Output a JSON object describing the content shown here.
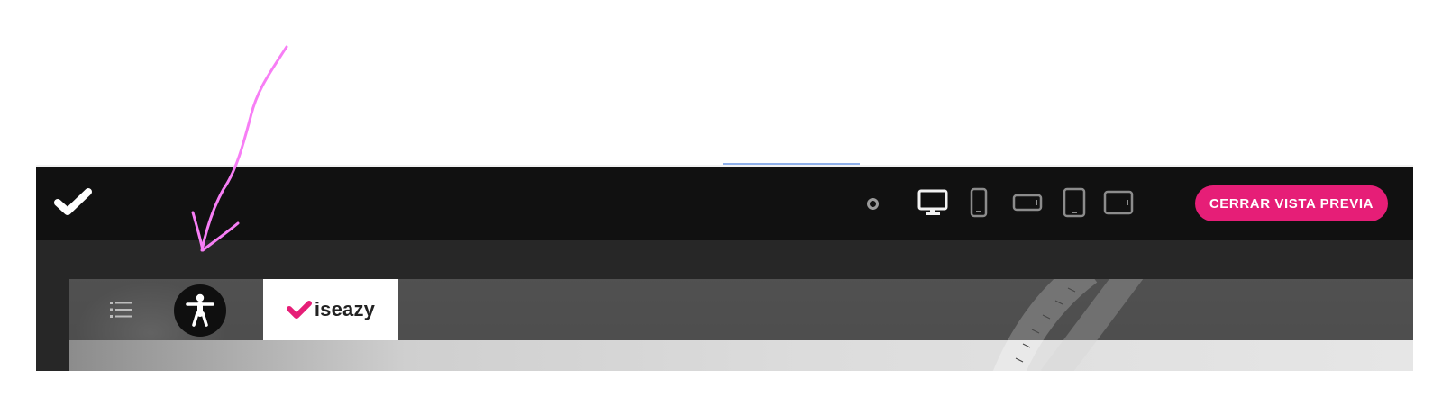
{
  "topbar": {
    "logo_icon": "checkmark-logo-icon",
    "preview_devices": [
      {
        "name": "desktop",
        "icon": "desktop-icon",
        "active": true
      },
      {
        "name": "mobile-portrait",
        "icon": "mobile-portrait-icon",
        "active": false
      },
      {
        "name": "mobile-landscape",
        "icon": "mobile-landscape-icon",
        "active": false
      },
      {
        "name": "tablet-portrait",
        "icon": "tablet-portrait-icon",
        "active": false
      },
      {
        "name": "tablet-landscape",
        "icon": "tablet-landscape-icon",
        "active": false
      }
    ],
    "close_preview_label": "CERRAR VISTA PREVIA"
  },
  "course_header": {
    "menu_icon": "list-menu-icon",
    "accessibility_icon": "accessibility-person-icon",
    "brand_name": "iseazy"
  },
  "colors": {
    "accent": "#e61e77",
    "topbar_bg": "#111111",
    "workspace_bg": "#272727",
    "annotation_arrow": "#f77ef5"
  }
}
